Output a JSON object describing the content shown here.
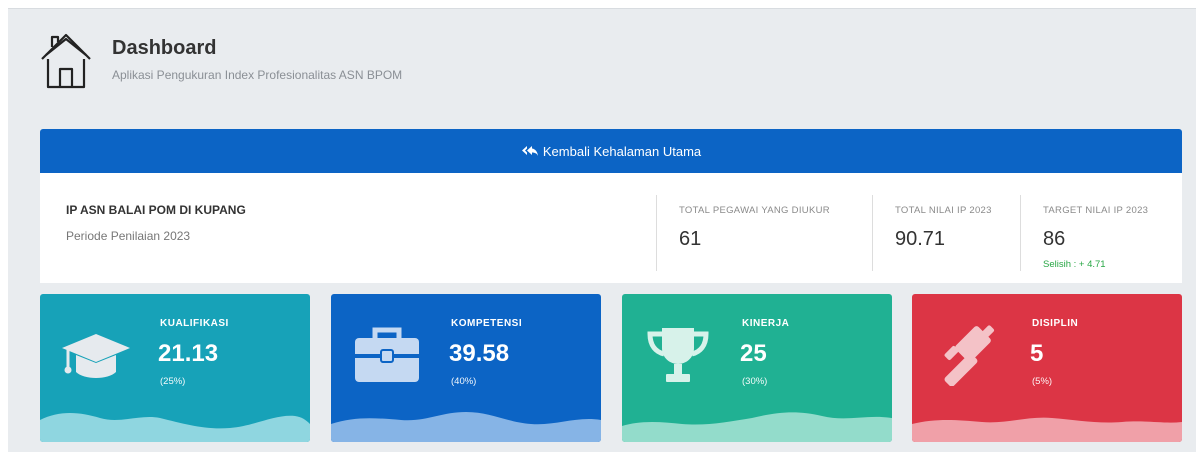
{
  "header": {
    "title": "Dashboard",
    "subtitle": "Aplikasi Pengukuran Index Profesionalitas ASN BPOM",
    "icon": "home-icon"
  },
  "back_bar": {
    "label": "Kembali Kehalaman Utama",
    "icon": "reply-all-icon",
    "color": "#0c64c5"
  },
  "info": {
    "unit_name": "IP ASN BALAI POM DI KUPANG",
    "period": "Periode Penilaian 2023",
    "stats": [
      {
        "label": "TOTAL PEGAWAI YANG DIUKUR",
        "value": "61"
      },
      {
        "label": "TOTAL NILAI IP 2023",
        "value": "90.71"
      },
      {
        "label": "TARGET NILAI IP 2023",
        "value": "86",
        "note": "Selisih : + 4.71"
      }
    ]
  },
  "cards": [
    {
      "label": "KUALIFIKASI",
      "value": "21.13",
      "percent": "(25%)",
      "icon": "graduation-cap-icon",
      "color": "#17a2b8",
      "wave_color": "#8fd6e0"
    },
    {
      "label": "KOMPETENSI",
      "value": "39.58",
      "percent": "(40%)",
      "icon": "toolbox-icon",
      "color": "#0c64c5",
      "wave_color": "#86b4e6"
    },
    {
      "label": "KINERJA",
      "value": "25",
      "percent": "(30%)",
      "icon": "trophy-icon",
      "color": "#20b193",
      "wave_color": "#93dccb"
    },
    {
      "label": "DISIPLIN",
      "value": "5",
      "percent": "(5%)",
      "icon": "gavel-icon",
      "color": "#dc3545",
      "wave_color": "#f0a0a8"
    }
  ]
}
